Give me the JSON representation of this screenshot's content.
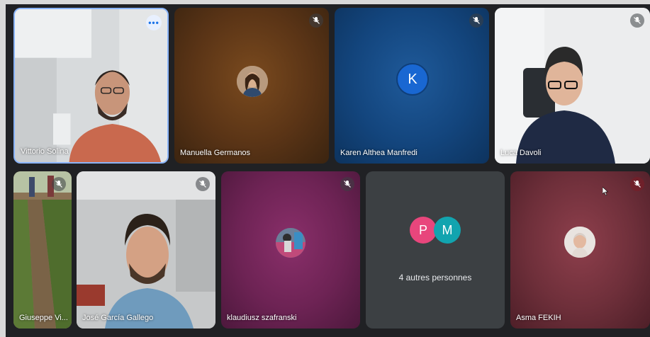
{
  "participants": [
    {
      "name": "Vittorio Solina",
      "has_more": true
    },
    {
      "name": "Manuella Germanos",
      "muted": true
    },
    {
      "name": "Karen Althea Manfredi",
      "initial": "K",
      "muted": true
    },
    {
      "name": "Luca Davoli",
      "muted": true
    },
    {
      "name": "Giuseppe Vi...",
      "muted": true
    },
    {
      "name": "José García Gallego",
      "muted": true
    },
    {
      "name": "klaudiusz szafranski",
      "muted": true
    },
    {
      "name": "Asma FEKIH",
      "muted": true
    }
  ],
  "others_tile": {
    "label": "4 autres personnes",
    "avatars": [
      {
        "initial": "P",
        "color": "#e8467c"
      },
      {
        "initial": "M",
        "color": "#12a4af"
      }
    ]
  },
  "more_options_symbol": "•••",
  "colors": {
    "background": "#202124",
    "karen_avatar": "#1967d2",
    "others_tile_bg": "#3c4043"
  }
}
